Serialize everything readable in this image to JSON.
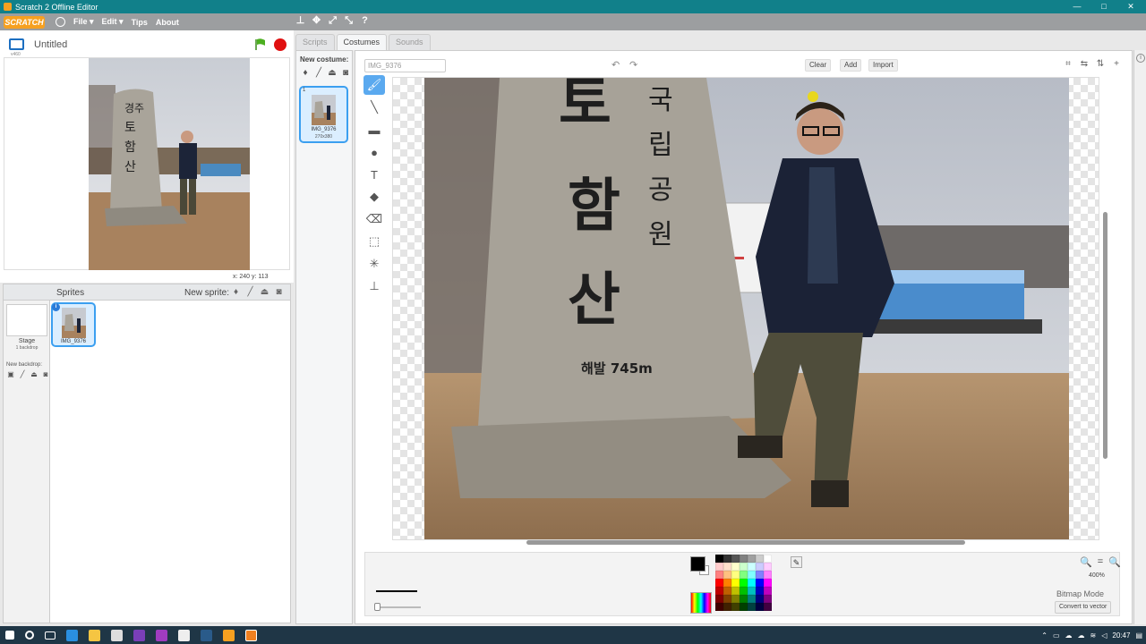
{
  "window": {
    "title": "Scratch 2 Offline Editor",
    "min": "—",
    "max": "□",
    "close": "✕"
  },
  "menu": {
    "logo": "SCRATCH",
    "file": "File ▾",
    "edit": "Edit ▾",
    "tips": "Tips",
    "about": "About"
  },
  "stage": {
    "version": "v460",
    "project_title": "Untitled",
    "coords": "x: 240   y: 113"
  },
  "sprites": {
    "header": "Sprites",
    "new_sprite": "New sprite:",
    "stage_label": "Stage",
    "backdrop_count": "1 backdrop",
    "new_backdrop": "New backdrop:",
    "items": [
      {
        "name": "IMG_9376"
      }
    ]
  },
  "tabs": [
    {
      "label": "Scripts"
    },
    {
      "label": "Costumes"
    },
    {
      "label": "Sounds"
    }
  ],
  "costumes": {
    "new_costume": "New costume:",
    "items": [
      {
        "index": "1",
        "name": "IMG_9376",
        "dims": "270x380"
      }
    ]
  },
  "editor": {
    "name_value": "IMG_9376",
    "clear": "Clear",
    "add": "Add",
    "import": "Import",
    "zoom": "400%",
    "zoom_out": "🔍",
    "zoom_reset": "=",
    "zoom_in": "🔍",
    "mode": "Bitmap Mode",
    "convert": "Convert to vector",
    "tools": [
      {
        "name": "brush-tool",
        "glyph": "🖌"
      },
      {
        "name": "line-tool",
        "glyph": "╲"
      },
      {
        "name": "rectangle-tool",
        "glyph": "▬"
      },
      {
        "name": "ellipse-tool",
        "glyph": "●"
      },
      {
        "name": "text-tool",
        "glyph": "T"
      },
      {
        "name": "fill-tool",
        "glyph": "◆"
      },
      {
        "name": "eraser-tool",
        "glyph": "⌫"
      },
      {
        "name": "select-tool",
        "glyph": "⬚"
      },
      {
        "name": "wand-tool",
        "glyph": "✳"
      },
      {
        "name": "stamp-tool",
        "glyph": "⊥"
      }
    ]
  },
  "palette": [
    "#000000",
    "#333333",
    "#555555",
    "#808080",
    "#a0a0a0",
    "#cccccc",
    "#ffffff",
    "#ffcccc",
    "#ffe0cc",
    "#ffffcc",
    "#ccffcc",
    "#ccffff",
    "#ccccff",
    "#ffccff",
    "#ff8080",
    "#ffc080",
    "#ffff80",
    "#80ff80",
    "#80ffff",
    "#8080ff",
    "#ff80ff",
    "#ff0000",
    "#ff8000",
    "#ffff00",
    "#00ff00",
    "#00ffff",
    "#0000ff",
    "#ff00ff",
    "#c00000",
    "#c06000",
    "#c0c000",
    "#00c000",
    "#00c0c0",
    "#0000c0",
    "#c000c0",
    "#800000",
    "#804000",
    "#808000",
    "#008000",
    "#008080",
    "#000080",
    "#800080",
    "#400000",
    "#402000",
    "#404000",
    "#004000",
    "#004040",
    "#000040",
    "#400040"
  ],
  "tray": {
    "time": "20:47"
  },
  "colors": {
    "accent": "#3b9ff0",
    "titlebar": "#11808a",
    "taskbar": "#1f3646"
  }
}
